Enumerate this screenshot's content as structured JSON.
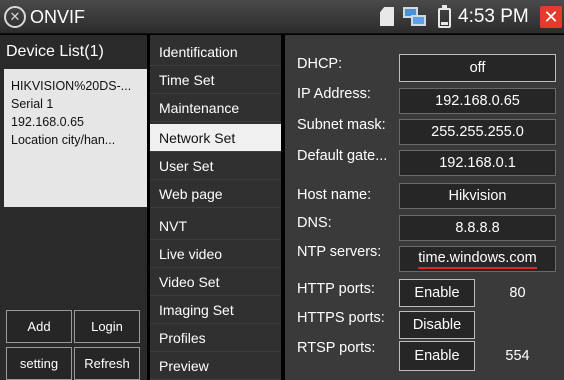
{
  "titlebar": {
    "app_title": "ONVIF",
    "clock": "4:53 PM",
    "close_glyph": "✕",
    "app_icon_glyph": "✕",
    "icons": [
      "onvif-app-icon",
      "sd-card-icon",
      "network-icon",
      "battery-icon",
      "close-icon"
    ],
    "close_color": "#e53a2c"
  },
  "device_list": {
    "header": "Device List(1)",
    "device": {
      "name": "HIKVISION%20DS-...",
      "serial": "Serial 1",
      "ip": "192.168.0.65",
      "location": "Location city/han..."
    },
    "buttons": {
      "add": "Add",
      "login": "Login",
      "setting": "setting",
      "refresh": "Refresh"
    }
  },
  "menu": {
    "items": [
      "Identification",
      "Time Set",
      "Maintenance",
      "Network Set",
      "User Set",
      "Web page",
      "NVT",
      "Live video",
      "Video Set",
      "Imaging Set",
      "Profiles",
      "Preview"
    ],
    "active": "Network Set"
  },
  "network": {
    "dhcp_label": "DHCP:",
    "dhcp_value": "off",
    "ip_label": "IP Address:",
    "ip_value": "192.168.0.65",
    "subnet_label": "Subnet mask:",
    "subnet_value": "255.255.255.0",
    "gateway_label": "Default gate...",
    "gateway_value": "192.168.0.1",
    "host_label": "Host name:",
    "host_value": "Hikvision",
    "dns_label": "DNS:",
    "dns_value": "8.8.8.8",
    "ntp_label": "NTP servers:",
    "ntp_value": "time.windows.com",
    "http_label": "HTTP ports:",
    "http_state": "Enable",
    "http_port": "80",
    "https_label": "HTTPS ports:",
    "https_state": "Disable",
    "https_port": "",
    "rtsp_label": "RTSP ports:",
    "rtsp_state": "Enable",
    "rtsp_port": "554"
  }
}
